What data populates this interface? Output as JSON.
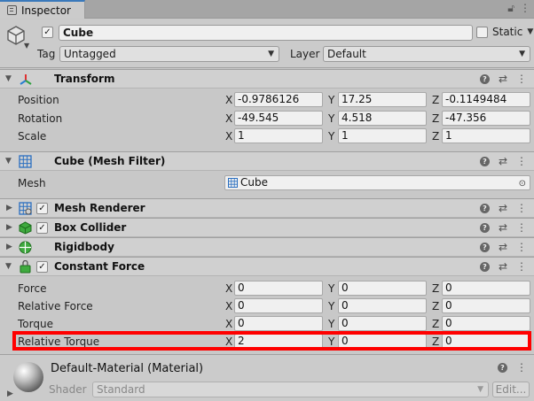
{
  "tab": {
    "label": "Inspector"
  },
  "header": {
    "active": "✓",
    "name": "Cube",
    "static_label": "Static",
    "tag_label": "Tag",
    "tag_value": "Untagged",
    "layer_label": "Layer",
    "layer_value": "Default"
  },
  "transform": {
    "title": "Transform",
    "rows": [
      {
        "label": "Position",
        "x": "-0.9786126",
        "y": "17.25",
        "z": "-0.1149484"
      },
      {
        "label": "Rotation",
        "x": "-49.545",
        "y": "4.518",
        "z": "-47.356"
      },
      {
        "label": "Scale",
        "x": "1",
        "y": "1",
        "z": "1"
      }
    ]
  },
  "mesh_filter": {
    "title": "Cube (Mesh Filter)",
    "mesh_label": "Mesh",
    "mesh_value": "Cube"
  },
  "mesh_renderer": {
    "title": "Mesh Renderer",
    "check": "✓"
  },
  "box_collider": {
    "title": "Box Collider",
    "check": "✓"
  },
  "rigidbody": {
    "title": "Rigidbody"
  },
  "constant_force": {
    "title": "Constant Force",
    "check": "✓",
    "rows": [
      {
        "label": "Force",
        "x": "0",
        "y": "0",
        "z": "0"
      },
      {
        "label": "Relative Force",
        "x": "0",
        "y": "0",
        "z": "0"
      },
      {
        "label": "Torque",
        "x": "0",
        "y": "0",
        "z": "0"
      },
      {
        "label": "Relative Torque",
        "x": "2",
        "y": "0",
        "z": "0"
      }
    ]
  },
  "axes": {
    "x": "X",
    "y": "Y",
    "z": "Z"
  },
  "material": {
    "title": "Default-Material (Material)",
    "shader_label": "Shader",
    "shader_value": "Standard",
    "edit_label": "Edit..."
  },
  "colors": {
    "accent": "#3a79bb",
    "highlight": "#ff0000"
  }
}
